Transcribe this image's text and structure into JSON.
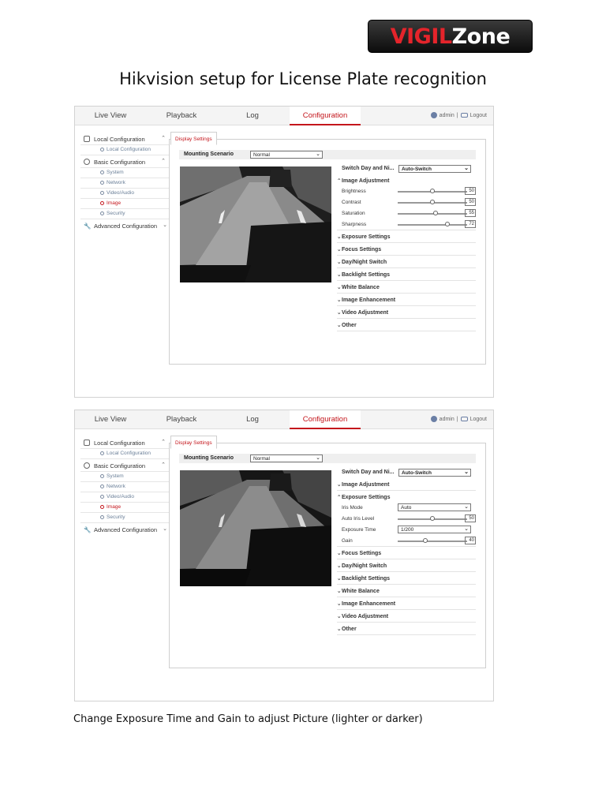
{
  "logo": {
    "part1": "VIGIL",
    "part2": "Zone"
  },
  "doc": {
    "title": "Hikvision setup for License Plate recognition",
    "caption": "Change Exposure Time and Gain to adjust Picture (lighter or darker)"
  },
  "shot1": {
    "nav": [
      "Live View",
      "Playback",
      "Log",
      "Configuration"
    ],
    "user": {
      "name": "admin",
      "separator": "|",
      "logout": "Logout"
    },
    "sidebar": {
      "local": "Local Configuration",
      "local_sub": "Local Configuration",
      "basic": "Basic Configuration",
      "basic_items": [
        "System",
        "Network",
        "Video/Audio",
        "Image",
        "Security"
      ],
      "advanced": "Advanced Configuration"
    },
    "tab": "Display Settings",
    "mounting": {
      "label": "Mounting Scenario",
      "value": "Normal"
    },
    "switch": {
      "label": "Switch Day and Ni...",
      "value": "Auto-Switch"
    },
    "image_adjustment": {
      "label": "Image Adjustment",
      "controls": [
        {
          "label": "Brightness",
          "value": 50
        },
        {
          "label": "Contrast",
          "value": 50
        },
        {
          "label": "Saturation",
          "value": 55
        },
        {
          "label": "Sharpness",
          "value": 72
        }
      ]
    },
    "sections": [
      "Exposure Settings",
      "Focus Settings",
      "Day/Night Switch",
      "Backlight Settings",
      "White Balance",
      "Image Enhancement",
      "Video Adjustment",
      "Other"
    ]
  },
  "shot2": {
    "nav": [
      "Live View",
      "Playback",
      "Log",
      "Configuration"
    ],
    "user": {
      "name": "admin",
      "separator": "|",
      "logout": "Logout"
    },
    "sidebar": {
      "local": "Local Configuration",
      "local_sub": "Local Configuration",
      "basic": "Basic Configuration",
      "basic_items": [
        "System",
        "Network",
        "Video/Audio",
        "Image",
        "Security"
      ],
      "advanced": "Advanced Configuration"
    },
    "tab": "Display Settings",
    "mounting": {
      "label": "Mounting Scenario",
      "value": "Normal"
    },
    "switch": {
      "label": "Switch Day and Ni...",
      "value": "Auto-Switch"
    },
    "image_adjustment": {
      "label": "Image Adjustment"
    },
    "exposure": {
      "label": "Exposure Settings",
      "iris_mode": {
        "label": "Iris Mode",
        "value": "Auto"
      },
      "auto_iris_level": {
        "label": "Auto Iris Level",
        "value": 50
      },
      "exposure_time": {
        "label": "Exposure Time",
        "value": "1/200"
      },
      "gain": {
        "label": "Gain",
        "value": 40
      }
    },
    "sections": [
      "Focus Settings",
      "Day/Night Switch",
      "Backlight Settings",
      "White Balance",
      "Image Enhancement",
      "Video Adjustment",
      "Other"
    ]
  },
  "colors": {
    "accent": "#c4161c",
    "logo_red": "#e4242b"
  }
}
